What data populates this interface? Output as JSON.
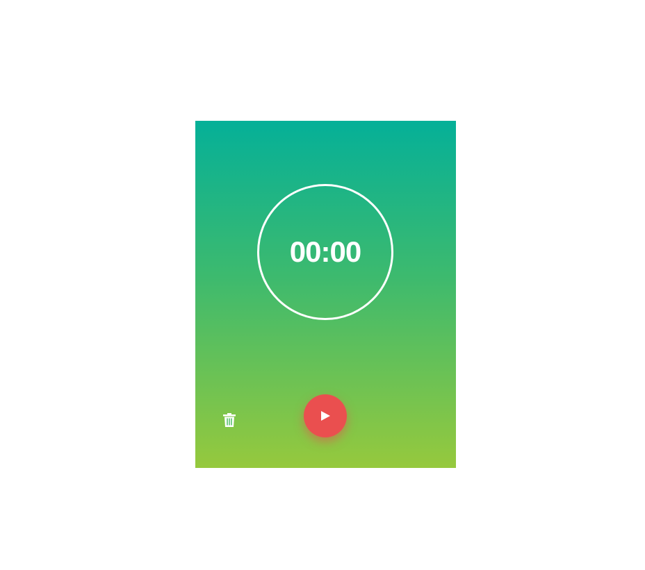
{
  "timer": {
    "display": "00:00"
  },
  "controls": {
    "delete_icon": "trash-icon",
    "play_icon": "play-icon"
  },
  "colors": {
    "gradient_top": "#05b098",
    "gradient_bottom": "#96c93d",
    "play_button": "#ea4f4f",
    "ring": "#ffffff"
  }
}
